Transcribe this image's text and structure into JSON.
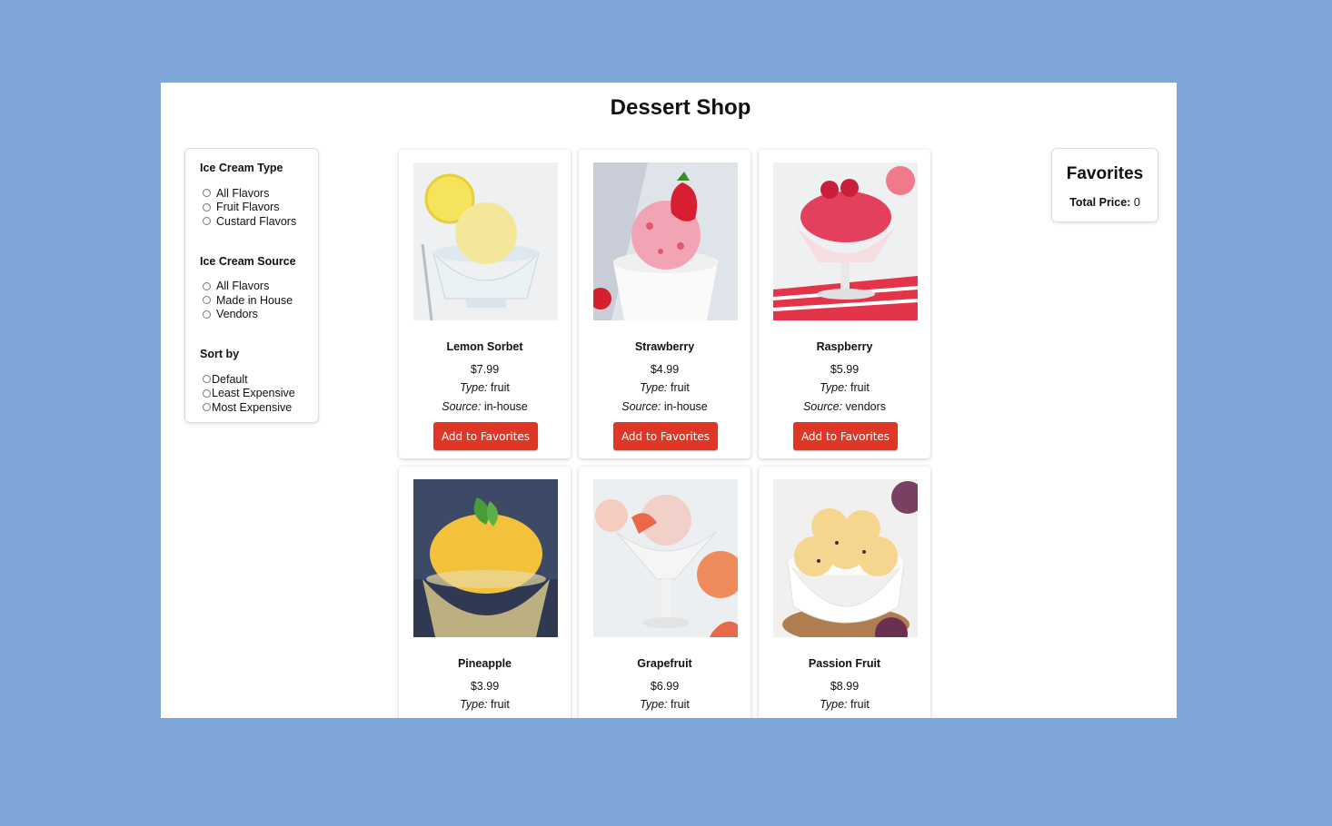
{
  "shop": {
    "title": "Dessert Shop"
  },
  "filters": {
    "type": {
      "title": "Ice Cream Type",
      "options": [
        "All Flavors",
        "Fruit Flavors",
        "Custard Flavors"
      ]
    },
    "source": {
      "title": "Ice Cream Source",
      "options": [
        "All Flavors",
        "Made in House",
        "Vendors"
      ]
    },
    "sort": {
      "title": "Sort by",
      "options": [
        "Default",
        "Least Expensive",
        "Most Expensive"
      ]
    }
  },
  "favorites": {
    "title": "Favorites",
    "total_label": "Total Price:",
    "total_value": "0"
  },
  "labels": {
    "type": "Type:",
    "source": "Source:",
    "add_button": "Add to Favorites"
  },
  "products": [
    {
      "name": "Lemon Sorbet",
      "price": "$7.99",
      "type": "fruit",
      "source": "in-house",
      "color": "#f4e79a"
    },
    {
      "name": "Strawberry",
      "price": "$4.99",
      "type": "fruit",
      "source": "in-house",
      "color": "#f2a4b4"
    },
    {
      "name": "Raspberry",
      "price": "$5.99",
      "type": "fruit",
      "source": "vendors",
      "color": "#e3405e"
    },
    {
      "name": "Pineapple",
      "price": "$3.99",
      "type": "fruit",
      "source": "",
      "color": "#f4c13a"
    },
    {
      "name": "Grapefruit",
      "price": "$6.99",
      "type": "fruit",
      "source": "",
      "color": "#f0d0c8"
    },
    {
      "name": "Passion Fruit",
      "price": "$8.99",
      "type": "fruit",
      "source": "",
      "color": "#f6d58e"
    }
  ]
}
